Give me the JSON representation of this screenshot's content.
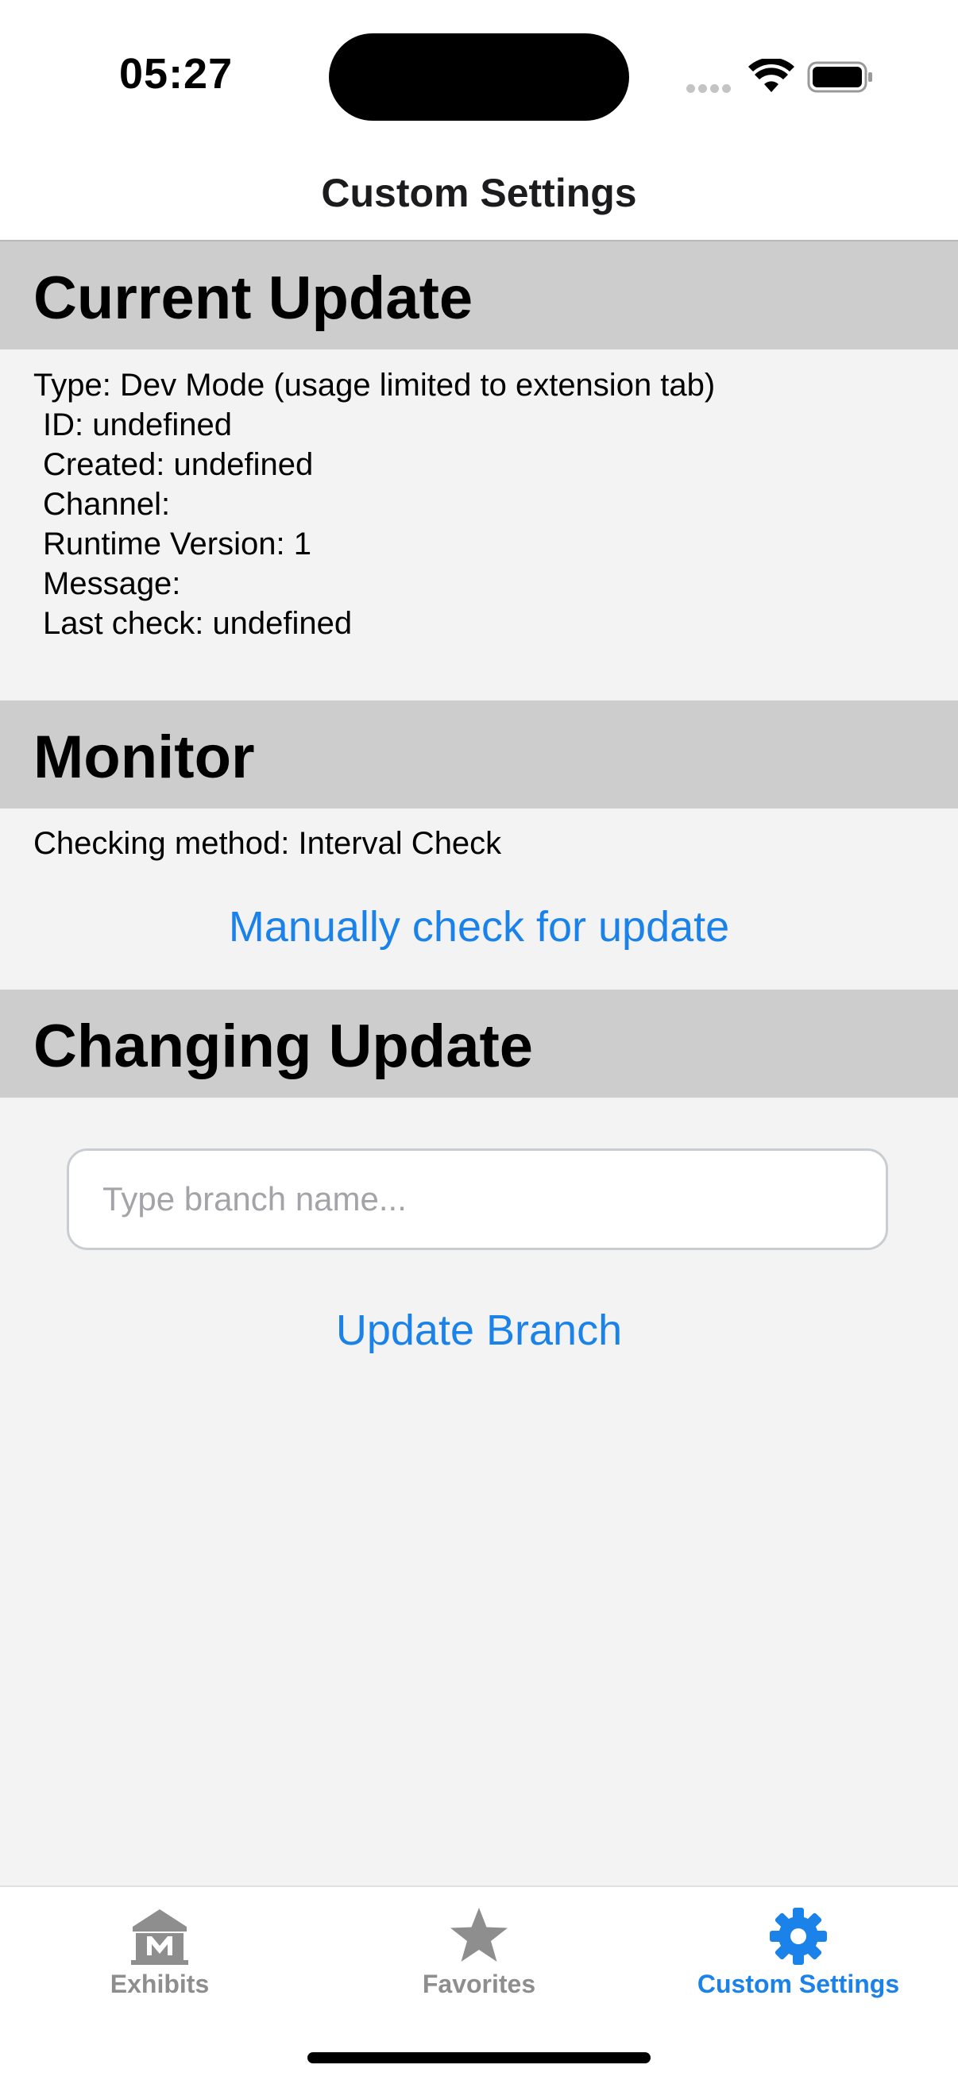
{
  "status_bar": {
    "time": "05:27"
  },
  "header": {
    "title": "Custom Settings"
  },
  "current_update": {
    "title": "Current Update",
    "lines": [
      "Type: Dev Mode (usage limited to extension tab)",
      "ID: undefined",
      "Created: undefined",
      "Channel: ",
      "Runtime Version: 1",
      "Message: ",
      "Last check: undefined"
    ]
  },
  "monitor": {
    "title": "Monitor",
    "checking_method": "Checking method: Interval Check",
    "check_button_label": "Manually check for update"
  },
  "changing_update": {
    "title": "Changing Update",
    "branch_input_value": "",
    "branch_input_placeholder": "Type branch name...",
    "update_button_label": "Update Branch"
  },
  "tab_bar": {
    "tabs": [
      {
        "label": "Exhibits",
        "icon": "museum-icon",
        "active": false
      },
      {
        "label": "Favorites",
        "icon": "star-icon",
        "active": false
      },
      {
        "label": "Custom Settings",
        "icon": "gear-icon",
        "active": true
      }
    ]
  },
  "colors": {
    "accent": "#1a82e9",
    "inactive_tab": "#8e8e8e",
    "section_header_bg": "#cdcdcd",
    "content_bg": "#f3f3f3"
  }
}
